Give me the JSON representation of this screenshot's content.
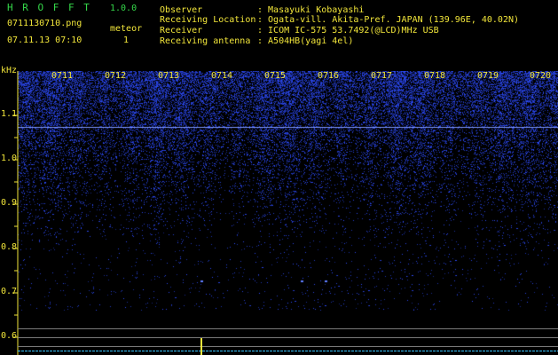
{
  "header": {
    "app_name": "H R O F F T",
    "version": "1.0.0",
    "file_name": "0711130710.png",
    "datetime": "07.11.13 07:10",
    "counter_label": "meteor",
    "counter_value": "1",
    "observer_label": "Observer",
    "observer_value": ": Masayuki Kobayashi",
    "location_label": "Receiving Location",
    "location_value": ": Ogata-vill. Akita-Pref. JAPAN (139.96E, 40.02N)",
    "receiver_label": "Receiver",
    "receiver_value": ": ICOM IC-575 53.7492(@LCD)MHz USB",
    "antenna_label": "Receiving antenna",
    "antenna_value": ": A504HB(yagi 4el)"
  },
  "plot": {
    "unit_label": "kHz",
    "y_ticks": [
      "1.1",
      "1.0",
      "0.9",
      "0.8",
      "0.7",
      "0.6"
    ],
    "time_labels": [
      "0711",
      "0712",
      "0713",
      "0714",
      "0715",
      "0716",
      "0717",
      "0718",
      "0719",
      "0720"
    ],
    "colors": {
      "background": "#000000",
      "noise": "#2a3fd8",
      "carrier": "#6f8cff",
      "text_yellow": "#f2e63a",
      "text_green": "#35d84a"
    }
  }
}
